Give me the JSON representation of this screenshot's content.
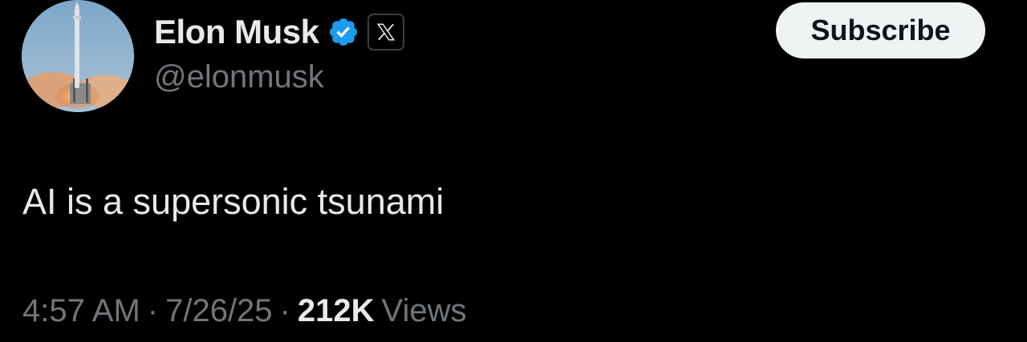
{
  "author": {
    "display_name": "Elon Musk",
    "handle": "@elonmusk",
    "verified_icon": "verified-badge-icon",
    "affiliation_icon": "x-logo-icon"
  },
  "actions": {
    "subscribe_label": "Subscribe"
  },
  "tweet": {
    "text": "AI is a supersonic tsunami"
  },
  "meta": {
    "time": "4:57 AM",
    "separator": "·",
    "date": "7/26/25",
    "views_count": "212K",
    "views_label": "Views"
  },
  "colors": {
    "background": "#000000",
    "primary_text": "#e7e9ea",
    "secondary_text": "#71767b",
    "verified_blue": "#1d9bf0",
    "subscribe_bg": "#eff3f4"
  }
}
